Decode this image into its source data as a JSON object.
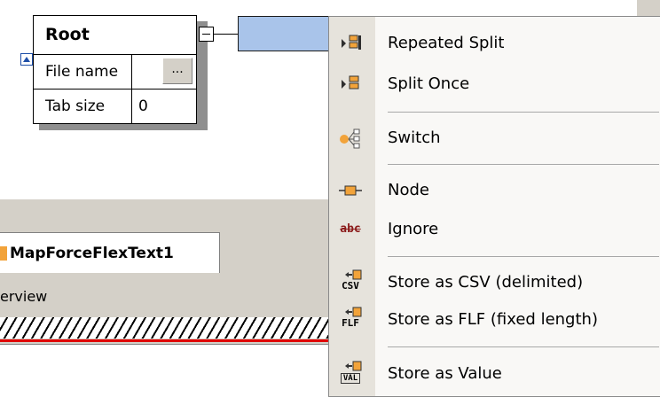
{
  "root_box": {
    "title": "Root",
    "rows": [
      {
        "label": "File name",
        "value": "",
        "button": "..."
      },
      {
        "label": "Tab size",
        "value": "0"
      }
    ]
  },
  "document_tab": {
    "label": "MapForceFlexText1"
  },
  "overview": {
    "label": "erview"
  },
  "context_menu": {
    "items": [
      {
        "label": "Repeated Split",
        "icon": "repeated-split-icon"
      },
      {
        "label": "Split Once",
        "icon": "split-once-icon"
      },
      {
        "label": "Switch",
        "icon": "switch-icon"
      },
      {
        "label": "Node",
        "icon": "node-icon"
      },
      {
        "label": "Ignore",
        "icon": "ignore-icon",
        "icon_text": "abc"
      },
      {
        "label": "Store as CSV (delimited)",
        "icon": "store-csv-icon",
        "icon_text": "CSV"
      },
      {
        "label": "Store as FLF (fixed length)",
        "icon": "store-flf-icon",
        "icon_text": "FLF"
      },
      {
        "label": "Store as Value",
        "icon": "store-value-icon",
        "icon_text": "VAL"
      }
    ]
  },
  "colors": {
    "split_node": "#a9c4ea",
    "accent_orange": "#f2a33a",
    "menu_icon_column": "#e6e3dc",
    "panel_gray": "#d4d0c8"
  }
}
